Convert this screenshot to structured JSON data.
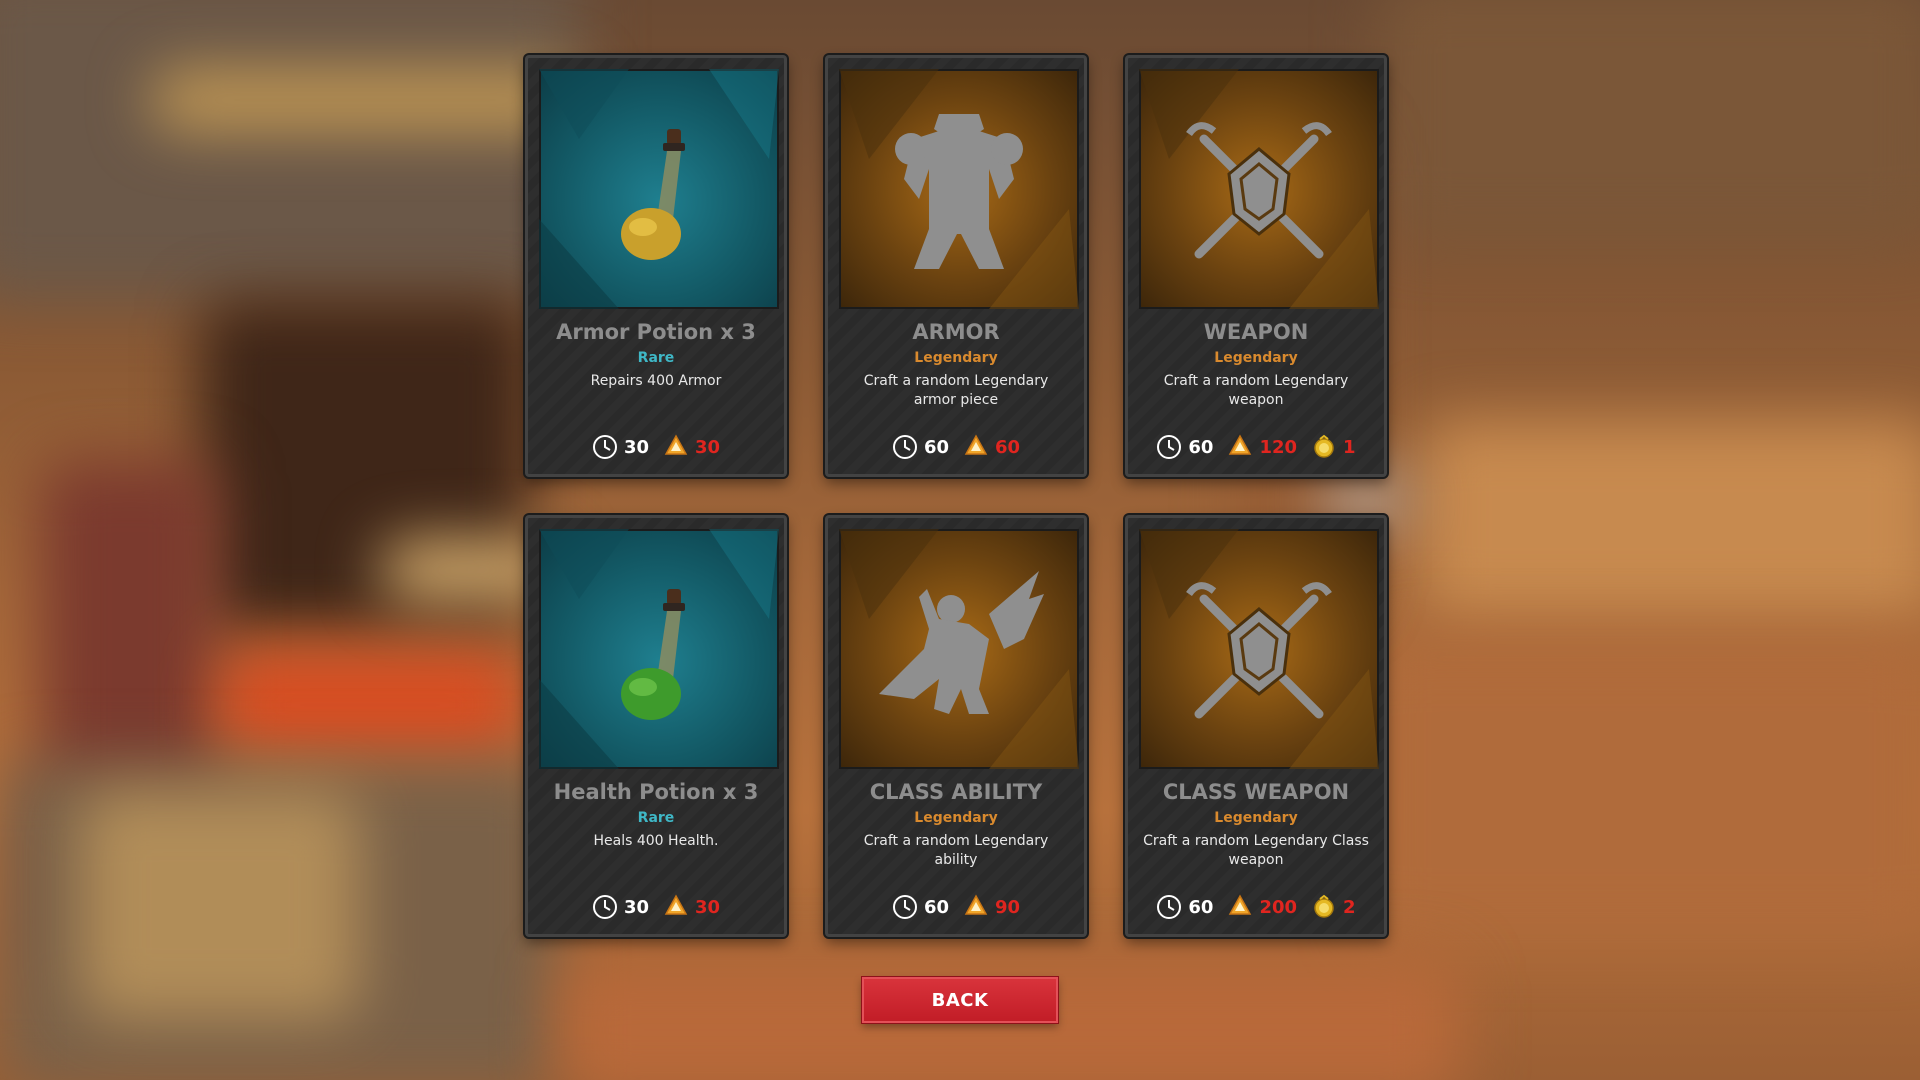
{
  "cards": [
    {
      "title": "Armor Potion x 3",
      "rarity": "Rare",
      "description": "Repairs 400 Armor",
      "art_icon": "armor-potion-icon",
      "time": "30",
      "resource": "30",
      "special": null
    },
    {
      "title": "ARMOR",
      "rarity": "Legendary",
      "description": "Craft a random Legendary armor piece",
      "art_icon": "armor-icon",
      "time": "60",
      "resource": "60",
      "special": null
    },
    {
      "title": "WEAPON",
      "rarity": "Legendary",
      "description": "Craft a random Legendary weapon",
      "art_icon": "crossed-swords-shield-icon",
      "time": "60",
      "resource": "120",
      "special": "1"
    },
    {
      "title": "Health Potion x 3",
      "rarity": "Rare",
      "description": "Heals 400 Health.",
      "art_icon": "health-potion-icon",
      "time": "30",
      "resource": "30",
      "special": null
    },
    {
      "title": "CLASS ABILITY",
      "rarity": "Legendary",
      "description": "Craft a random Legendary ability",
      "art_icon": "hero-ability-icon",
      "time": "60",
      "resource": "90",
      "special": null
    },
    {
      "title": "CLASS WEAPON",
      "rarity": "Legendary",
      "description": "Craft a random Legendary Class weapon",
      "art_icon": "crossed-swords-shield-icon",
      "time": "60",
      "resource": "200",
      "special": "2"
    }
  ],
  "back_label": "BACK",
  "colors": {
    "rare": "#3fb7c6",
    "legendary": "#d98a2e",
    "cost_red": "#e0251f",
    "button_red": "#c21d27"
  }
}
